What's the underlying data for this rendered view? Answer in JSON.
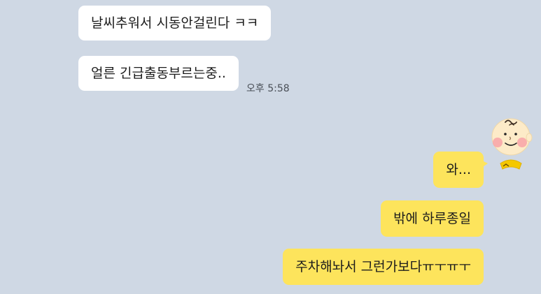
{
  "chat": {
    "incoming": [
      {
        "text": "날씨추워서 시동안걸린다 ㅋㅋ"
      },
      {
        "text": "얼른 긴급출동부르는중.."
      }
    ],
    "incoming_time": "오후 5:58",
    "outgoing": [
      {
        "text": "와..."
      },
      {
        "text": "밖에 하루종일"
      },
      {
        "text": "주차해놔서 그런가보다ㅠㅜㅠㅜ"
      }
    ]
  },
  "colors": {
    "background": "#cfd8e4",
    "incoming_bubble": "#ffffff",
    "outgoing_bubble": "#fde45c"
  },
  "icons": {
    "avatar": "charlie-brown-face-icon"
  }
}
